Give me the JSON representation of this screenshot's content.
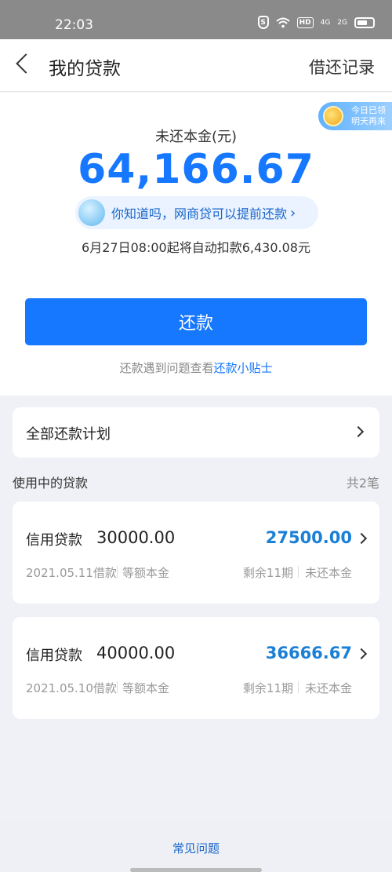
{
  "status_bar": {
    "time": "22:03",
    "icons": [
      "shield-s-icon",
      "wifi-icon",
      "hd-icon",
      "4g-signal-icon",
      "2g-signal-icon",
      "battery-icon"
    ],
    "shield_glyph": "S",
    "hd_label": "HD",
    "sig1_label": "4G",
    "sig2_label": "2G"
  },
  "header": {
    "title": "我的贷款",
    "records_link": "借还记录"
  },
  "summary": {
    "reward_badge_line1": "今日已领",
    "reward_badge_line2": "明天再来",
    "principal_label": "未还本金(元)",
    "principal_amount": "64,166.67",
    "tip_text": "你知道吗，网商贷可以提前还款",
    "auto_debit_text": "6月27日08:00起将自动扣款6,430.08元",
    "repay_button": "还款",
    "help_prefix": "还款遇到问题查看",
    "help_link": "还款小贴士"
  },
  "plan": {
    "label": "全部还款计划"
  },
  "loans_section": {
    "title": "使用中的贷款",
    "count": "共2笔",
    "loans": [
      {
        "type": "信用贷款",
        "amount": "30000.00",
        "remaining": "27500.00",
        "date": "2021.05.11借款",
        "method": "等额本金",
        "terms": "剩余11期",
        "status": "未还本金"
      },
      {
        "type": "信用贷款",
        "amount": "40000.00",
        "remaining": "36666.67",
        "date": "2021.05.10借款",
        "method": "等额本金",
        "terms": "剩余11期",
        "status": "未还本金"
      }
    ]
  },
  "footer": {
    "faq": "常见问题"
  },
  "colors": {
    "accent": "#1677ff",
    "amount_blue": "#1a7fd6",
    "status_bar": "#8a8a8a",
    "page_bg": "#eff1f6"
  }
}
